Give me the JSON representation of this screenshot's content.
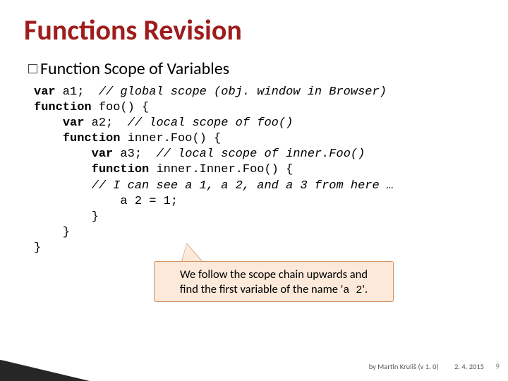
{
  "title": "Functions Revision",
  "subtitle_prefix": "Function",
  "subtitle_rest": " Scope of Variables",
  "code_lines": {
    "l1a": "var",
    "l1b": " a1;  ",
    "l1c": "// global scope (obj. window in Browser)",
    "l2a": "function",
    "l2b": " foo() {",
    "l3a": "    ",
    "l3b": "var",
    "l3c": " a2;  ",
    "l3d": "// local scope of foo()",
    "l4a": "    ",
    "l4b": "function",
    "l4c": " inner.Foo() {",
    "l5a": "        ",
    "l5b": "var",
    "l5c": " a3;  ",
    "l5d": "// local scope of inner.Foo()",
    "l6a": "        ",
    "l6b": "function",
    "l6c": " inner.Inner.Foo() {",
    "l7a": "        ",
    "l7b": "// I can see a 1, a 2, and a 3 from here …",
    "l8a": "            a 2 = 1;",
    "l9": "        }",
    "l10": "    }",
    "l11": "}"
  },
  "callout_line1": "We follow the scope chain upwards and",
  "callout_line2_a": "find the first variable of the name '",
  "callout_line2_var": "a 2",
  "callout_line2_b": "'.",
  "footer": {
    "author": "by Martin Kruliš (v 1. 0)",
    "date": "2. 4. 2015",
    "page": "9"
  }
}
